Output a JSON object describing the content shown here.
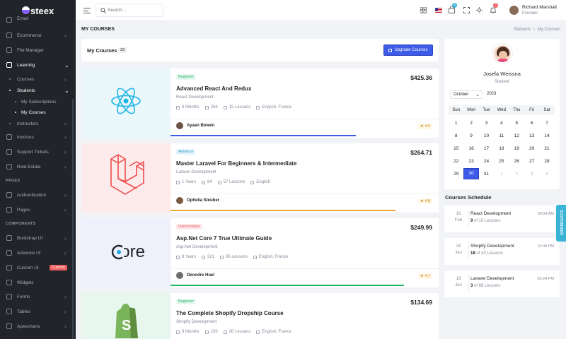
{
  "brand": {
    "name": "steex"
  },
  "sidebar": {
    "items": [
      {
        "label": "Email"
      },
      {
        "label": "Ecommerce"
      },
      {
        "label": "File Manager"
      },
      {
        "label": "Learning"
      },
      {
        "label": "Courses"
      },
      {
        "label": "Students"
      },
      {
        "label": "My Subscriptions"
      },
      {
        "label": "My Courses"
      },
      {
        "label": "Instructors"
      },
      {
        "label": "Invoices"
      },
      {
        "label": "Support Tickets"
      },
      {
        "label": "Real Estate"
      },
      {
        "label": "Authentication"
      },
      {
        "label": "Pages"
      },
      {
        "label": "Bootstrap UI"
      },
      {
        "label": "Advance UI"
      },
      {
        "label": "Custom UI"
      },
      {
        "label": "Widgets"
      },
      {
        "label": "Forms"
      },
      {
        "label": "Tables"
      },
      {
        "label": "Apexcharts"
      }
    ],
    "section_pages": "PAGES",
    "section_components": "COMPONENTS",
    "custom_badge": "Custom"
  },
  "topbar": {
    "search_placeholder": "Search...",
    "cart_count": "5",
    "notif_count": "3",
    "user_name": "Richard Marshall",
    "user_role": "Founder"
  },
  "page": {
    "title": "MY COURSES",
    "breadcrumb_parent": "Students",
    "breadcrumb_sep": "›",
    "breadcrumb_current": "My Courses"
  },
  "list_header": {
    "title": "My Courses",
    "count": "23",
    "upgrade_label": "Upgrade Courses"
  },
  "courses": [
    {
      "level": "Beginner",
      "price": "$425.36",
      "title": "Advanced React And Redux",
      "category": "React Development",
      "duration": "6 Months",
      "students": "256",
      "lessons": "15 Lessons",
      "language": "English, France",
      "instructor": "Ayaan Bowen",
      "rating": "4.5",
      "progress": 0.69
    },
    {
      "level": "Advance",
      "price": "$264.71",
      "title": "Master Laravel For Beginners & Intermediate",
      "category": "Laravel Development",
      "duration": "1 Years",
      "students": "84",
      "lessons": "57 Lessons",
      "language": "English",
      "instructor": "Ophelia Steuber",
      "rating": "4.8",
      "progress": 0.84
    },
    {
      "level": "Intermediate",
      "price": "$249.99",
      "title": "Asp.Net Core 7 True Ultimate Guide",
      "category": "Asp.Net Development",
      "duration": "8 Years",
      "students": "321",
      "lessons": "95 Lessons",
      "language": "English, France",
      "instructor": "Deondre Huel",
      "rating": "4.7",
      "progress": 0.87
    },
    {
      "level": "Beginner",
      "price": "$134.69",
      "title": "The Complete Shopify Dropship Course",
      "category": "Shopify Development",
      "duration": "9 Months",
      "students": "150",
      "lessons": "30 Lessons",
      "language": "English, France",
      "instructor": "",
      "rating": "",
      "progress": 0
    }
  ],
  "thumb_text": {
    "aspnet": "Core"
  },
  "profile": {
    "name": "Josefa Weissna",
    "role": "Student"
  },
  "calendar": {
    "month": "October",
    "year": "2023",
    "weekdays": [
      "Sun",
      "Mon",
      "Tue",
      "Wed",
      "Thu",
      "Fri",
      "Sat"
    ],
    "weeks": [
      [
        "1",
        "2",
        "3",
        "4",
        "5",
        "6",
        "7"
      ],
      [
        "8",
        "9",
        "10",
        "11",
        "12",
        "13",
        "14"
      ],
      [
        "15",
        "16",
        "17",
        "18",
        "19",
        "20",
        "21"
      ],
      [
        "22",
        "23",
        "24",
        "25",
        "26",
        "27",
        "28"
      ],
      [
        "29",
        "30",
        "31",
        "1",
        "2",
        "3",
        "4"
      ]
    ],
    "selected": "30"
  },
  "schedule": {
    "title": "Courses Schedule",
    "items": [
      {
        "day": "16",
        "month": "Feb",
        "title": "React Development",
        "done": "9",
        "of": "of 15 Lessons",
        "time": "08:54 AM"
      },
      {
        "day": "28",
        "month": "Jan",
        "title": "Shopify Development",
        "done": "18",
        "of": "of 43 Lessons",
        "time": "10:49 PM"
      },
      {
        "day": "19",
        "month": "Jan",
        "title": "Laravel Development",
        "done": "3",
        "of": "of 68 Lessons",
        "time": "03:24 PM"
      }
    ]
  },
  "customizer_label": "CUSTOMIZER",
  "colors": {
    "primary": "#3d5be7",
    "sidebar": "#212529",
    "success": "#27b56b",
    "warning": "#f5a63a",
    "danger": "#ed5e5e"
  }
}
